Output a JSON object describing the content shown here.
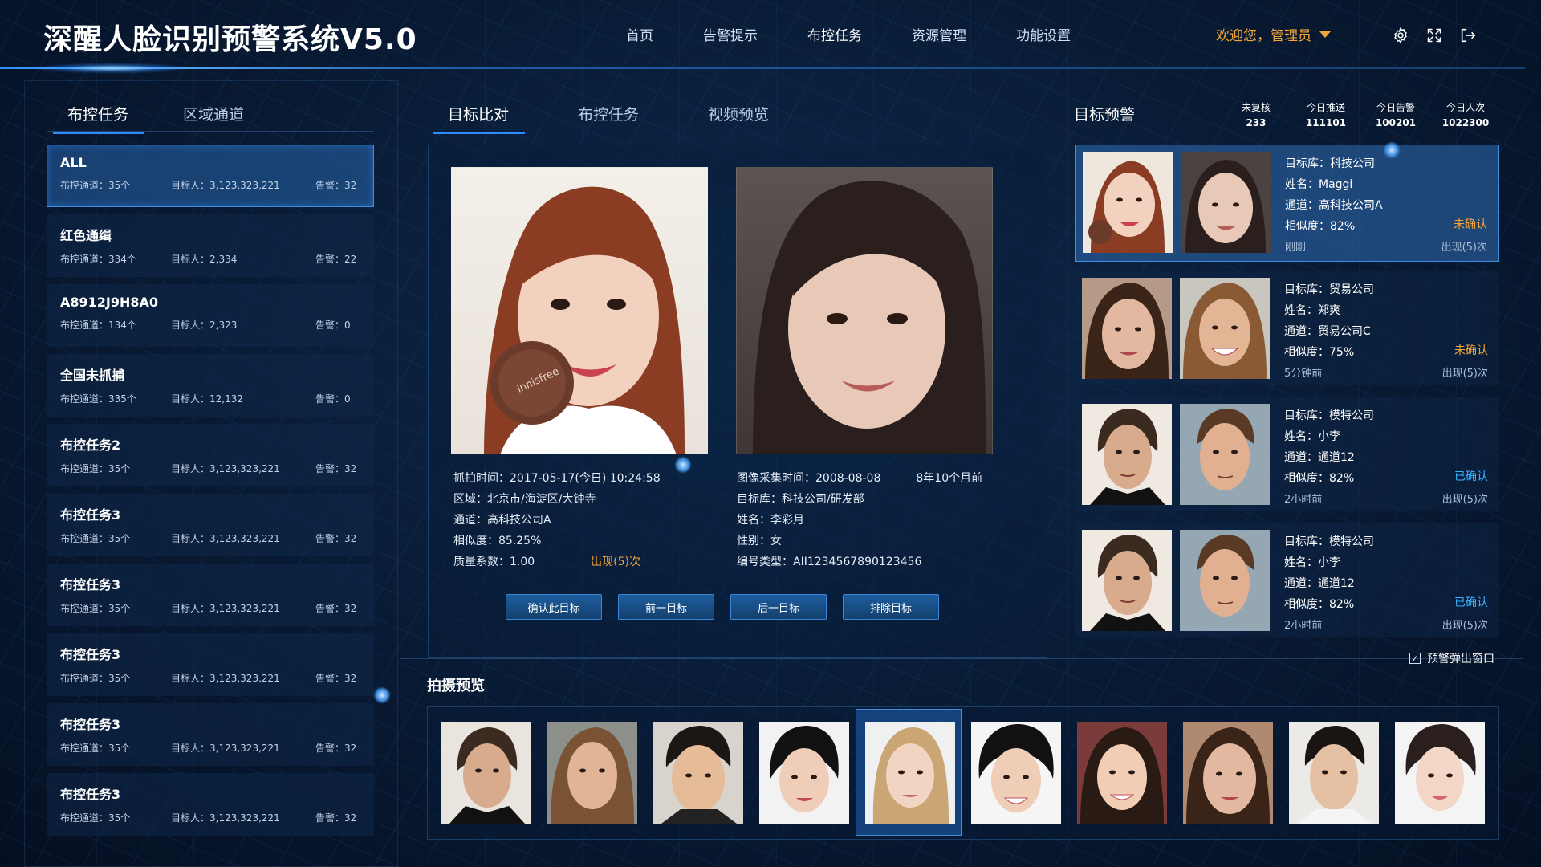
{
  "header": {
    "title": "深醒人脸识别预警系统V5.0",
    "nav": [
      "首页",
      "告警提示",
      "布控任务",
      "资源管理",
      "功能设置"
    ],
    "user": "欢迎您，管理员",
    "icons": [
      "gear-icon",
      "fullscreen-icon",
      "logout-icon"
    ]
  },
  "left": {
    "tabs": [
      "布控任务",
      "区域通道"
    ],
    "tasks": [
      {
        "name": "ALL",
        "channels": "布控通道：35个",
        "targets": "目标人：3,123,323,221",
        "alerts": "告警：32"
      },
      {
        "name": "红色通缉",
        "channels": "布控通道：334个",
        "targets": "目标人：2,334",
        "alerts": "告警：22"
      },
      {
        "name": "A8912J9H8A0",
        "channels": "布控通道：134个",
        "targets": "目标人：2,323",
        "alerts": "告警：0"
      },
      {
        "name": "全国未抓捕",
        "channels": "布控通道：335个",
        "targets": "目标人：12,132",
        "alerts": "告警：0"
      },
      {
        "name": "布控任务2",
        "channels": "布控通道：35个",
        "targets": "目标人：3,123,323,221",
        "alerts": "告警：32"
      },
      {
        "name": "布控任务3",
        "channels": "布控通道：35个",
        "targets": "目标人：3,123,323,221",
        "alerts": "告警：32"
      },
      {
        "name": "布控任务3",
        "channels": "布控通道：35个",
        "targets": "目标人：3,123,323,221",
        "alerts": "告警：32"
      },
      {
        "name": "布控任务3",
        "channels": "布控通道：35个",
        "targets": "目标人：3,123,323,221",
        "alerts": "告警：32"
      },
      {
        "name": "布控任务3",
        "channels": "布控通道：35个",
        "targets": "目标人：3,123,323,221",
        "alerts": "告警：32"
      },
      {
        "name": "布控任务3",
        "channels": "布控通道：35个",
        "targets": "目标人：3,123,323,221",
        "alerts": "告警：32"
      }
    ]
  },
  "center": {
    "tabs": [
      "目标比对",
      "布控任务",
      "视频预览"
    ],
    "capture": {
      "time": "抓拍时间：2017-05-17(今日)   10:24:58",
      "area": "区域：北京市/海淀区/大钟寺",
      "channel": "通道：高科技公司A",
      "similarity": "相似度：85.25%",
      "quality": "质量系数：1.00",
      "appear": "出现(5)次"
    },
    "target": {
      "collect_time": "图像采集时间：2008-08-08",
      "ago": "8年10个月前",
      "library": "目标库：科技公司/研发部",
      "name": "姓名：李彩月",
      "gender": "性别：女",
      "id_type": "编号类型：AII1234567890123456"
    },
    "buttons": [
      "确认此目标",
      "前一目标",
      "后一目标",
      "排除目标"
    ]
  },
  "right": {
    "title": "目标预警",
    "stats": [
      {
        "label": "未复核",
        "value": "233"
      },
      {
        "label": "今日推送",
        "value": "111101"
      },
      {
        "label": "今日告警",
        "value": "100201"
      },
      {
        "label": "今日人次",
        "value": "1022300"
      }
    ],
    "alerts": [
      {
        "library": "目标库：科技公司",
        "name": "姓名：Maggi",
        "channel": "通道：高科技公司A",
        "similarity": "相似度：82%",
        "status": "未确认",
        "time": "刚刚",
        "count": "出现(5)次",
        "status_color": "#f0a63a"
      },
      {
        "library": "目标库：贸易公司",
        "name": "姓名：郑爽",
        "channel": "通道：贸易公司C",
        "similarity": "相似度：75%",
        "status": "未确认",
        "time": "5分钟前",
        "count": "出现(5)次",
        "status_color": "#f0a63a"
      },
      {
        "library": "目标库：模特公司",
        "name": "姓名：小李",
        "channel": "通道：通道12",
        "similarity": "相似度：82%",
        "status": "已确认",
        "time": "2小时前",
        "count": "出现(5)次",
        "status_color": "#37b2ff"
      },
      {
        "library": "目标库：模特公司",
        "name": "姓名：小李",
        "channel": "通道：通道12",
        "similarity": "相似度：82%",
        "status": "已确认",
        "time": "2小时前",
        "count": "出现(5)次",
        "status_color": "#37b2ff"
      }
    ],
    "popup_label": "预警弹出窗口"
  },
  "preview": {
    "title": "拍摄预览"
  },
  "colors": {
    "accent": "#2f8bff",
    "orange": "#f0a63a",
    "blue": "#37b2ff"
  }
}
